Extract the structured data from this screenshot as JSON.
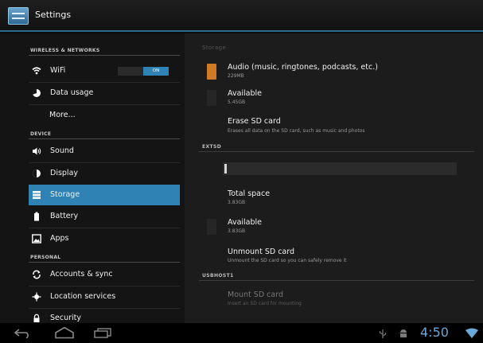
{
  "app": {
    "title": "Settings",
    "icon": "settings-app-icon"
  },
  "sidebar": {
    "sections": [
      {
        "header": "WIRELESS & NETWORKS"
      },
      {
        "header": "DEVICE"
      },
      {
        "header": "PERSONAL"
      }
    ],
    "items": [
      {
        "label": "WiFi",
        "icon": "wifi-icon",
        "toggle": "ON"
      },
      {
        "label": "Data usage",
        "icon": "data-usage-icon"
      },
      {
        "label": "More..."
      },
      {
        "label": "Sound",
        "icon": "sound-icon"
      },
      {
        "label": "Display",
        "icon": "display-icon"
      },
      {
        "label": "Storage",
        "icon": "storage-icon",
        "selected": true
      },
      {
        "label": "Battery",
        "icon": "battery-icon"
      },
      {
        "label": "Apps",
        "icon": "apps-icon"
      },
      {
        "label": "Accounts & sync",
        "icon": "sync-icon"
      },
      {
        "label": "Location services",
        "icon": "location-icon"
      },
      {
        "label": "Security",
        "icon": "lock-icon"
      }
    ]
  },
  "main": {
    "top_section": "Storage",
    "audio": {
      "title": "Audio (music, ringtones, podcasts, etc.)",
      "value": "229MB",
      "color": "#d07a26"
    },
    "internal_available": {
      "title": "Available",
      "value": "5.45GB"
    },
    "erase_sd": {
      "title": "Erase SD card",
      "subtitle": "Erases all data on the SD card, such as music and photos"
    },
    "extsd": {
      "header": "EXTSD",
      "total_space": {
        "title": "Total space",
        "value": "3.83GB"
      },
      "available": {
        "title": "Available",
        "value": "3.83GB"
      },
      "unmount": {
        "title": "Unmount SD card",
        "subtitle": "Unmount the SD card so you can safely remove it"
      }
    },
    "usbhost": {
      "header": "USBHOST1",
      "mount": {
        "title": "Mount SD card",
        "subtitle": "Insert an SD card for mounting"
      }
    }
  },
  "navbar": {
    "time": "4:50"
  },
  "colors": {
    "accent": "#2f82b4",
    "clock": "#6aa8d8"
  }
}
